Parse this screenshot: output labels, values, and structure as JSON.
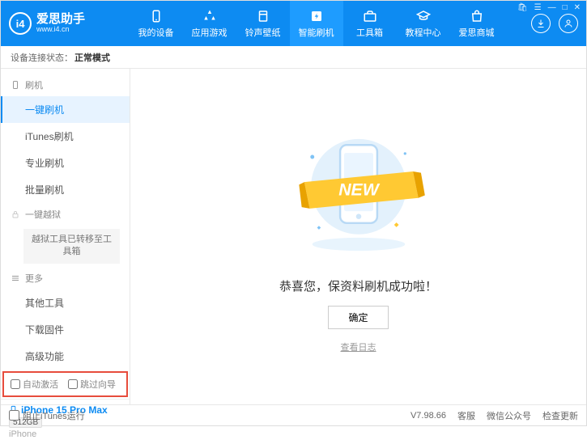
{
  "app": {
    "title": "爱思助手",
    "url": "www.i4.cn",
    "logo_letter": "i4"
  },
  "win": {
    "menu": "☰",
    "min": "—",
    "max": "□",
    "close": "✕",
    "shopping": "🛍"
  },
  "nav": {
    "items": [
      {
        "label": "我的设备"
      },
      {
        "label": "应用游戏"
      },
      {
        "label": "铃声壁纸"
      },
      {
        "label": "智能刷机"
      },
      {
        "label": "工具箱"
      },
      {
        "label": "教程中心"
      },
      {
        "label": "爱思商城"
      }
    ]
  },
  "status": {
    "label": "设备连接状态：",
    "value": "正常模式"
  },
  "sidebar": {
    "group_flash": "刷机",
    "items_flash": [
      "一键刷机",
      "iTunes刷机",
      "专业刷机",
      "批量刷机"
    ],
    "group_jailbreak": "一键越狱",
    "jailbreak_note": "越狱工具已转移至工具箱",
    "group_more": "更多",
    "items_more": [
      "其他工具",
      "下载固件",
      "高级功能"
    ],
    "cb_auto_activate": "自动激活",
    "cb_skip_guide": "跳过向导"
  },
  "device": {
    "name": "iPhone 15 Pro Max",
    "storage": "512GB",
    "type": "iPhone"
  },
  "main": {
    "new_badge": "NEW",
    "congrats": "恭喜您，保资料刷机成功啦！",
    "ok": "确定",
    "view_log": "查看日志"
  },
  "footer": {
    "block_itunes": "阻止iTunes运行",
    "version": "V7.98.66",
    "service": "客服",
    "wechat": "微信公众号",
    "check_update": "检查更新"
  }
}
